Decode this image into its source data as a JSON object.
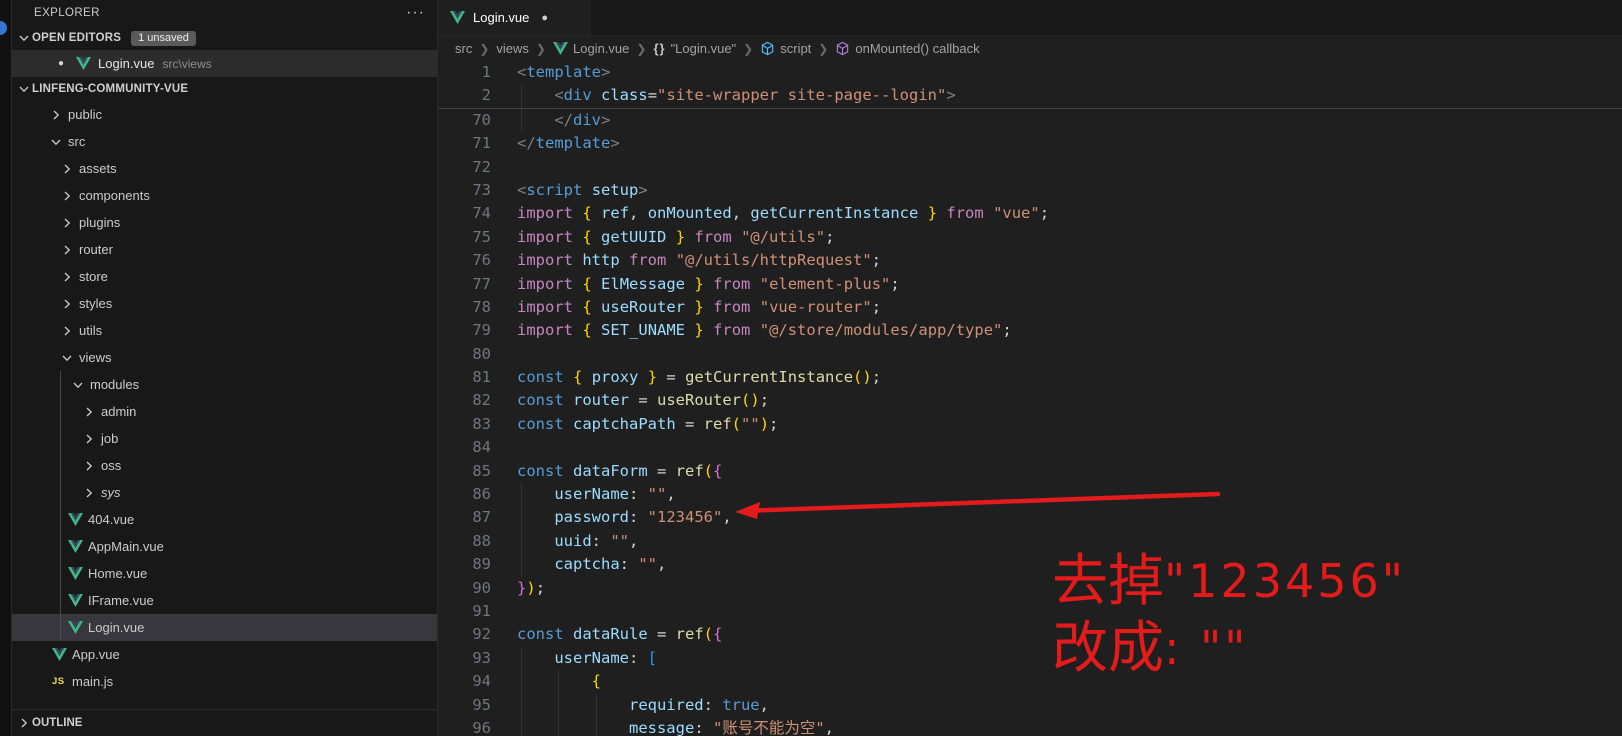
{
  "colors": {
    "annotation_red": "#e31b1b",
    "vue_green": "#41b883",
    "vue_dark": "#35495e",
    "activity_badge_blue": "#3574d4",
    "cube_blue": "#4fc1ff",
    "cube_purple": "#b180d7"
  },
  "explorer": {
    "title": "EXPLORER",
    "actions_icon": "···",
    "open_editors": {
      "label": "OPEN EDITORS",
      "badge": "1 unsaved",
      "items": [
        {
          "name": "Login.vue",
          "path": "src\\views",
          "modified": true,
          "icon": "vue"
        }
      ]
    },
    "project": {
      "label": "LINFENG-COMMUNITY-VUE",
      "tree": [
        {
          "label": "public",
          "kind": "folder",
          "expanded": false,
          "depth": 0
        },
        {
          "label": "src",
          "kind": "folder",
          "expanded": true,
          "depth": 0
        },
        {
          "label": "assets",
          "kind": "folder",
          "expanded": false,
          "depth": 1
        },
        {
          "label": "components",
          "kind": "folder",
          "expanded": false,
          "depth": 1
        },
        {
          "label": "plugins",
          "kind": "folder",
          "expanded": false,
          "depth": 1
        },
        {
          "label": "router",
          "kind": "folder",
          "expanded": false,
          "depth": 1
        },
        {
          "label": "store",
          "kind": "folder",
          "expanded": false,
          "depth": 1
        },
        {
          "label": "styles",
          "kind": "folder",
          "expanded": false,
          "depth": 1
        },
        {
          "label": "utils",
          "kind": "folder",
          "expanded": false,
          "depth": 1
        },
        {
          "label": "views",
          "kind": "folder",
          "expanded": true,
          "depth": 1
        },
        {
          "label": "modules",
          "kind": "folder",
          "expanded": true,
          "depth": 2
        },
        {
          "label": "admin",
          "kind": "folder",
          "expanded": false,
          "depth": 3
        },
        {
          "label": "job",
          "kind": "folder",
          "expanded": false,
          "depth": 3
        },
        {
          "label": "oss",
          "kind": "folder",
          "expanded": false,
          "depth": 3
        },
        {
          "label": "sys",
          "kind": "folder",
          "expanded": false,
          "depth": 3,
          "italic": true
        },
        {
          "label": "404.vue",
          "kind": "vue",
          "depth": 2
        },
        {
          "label": "AppMain.vue",
          "kind": "vue",
          "depth": 2
        },
        {
          "label": "Home.vue",
          "kind": "vue",
          "depth": 2
        },
        {
          "label": "IFrame.vue",
          "kind": "vue",
          "depth": 2
        },
        {
          "label": "Login.vue",
          "kind": "vue",
          "depth": 2,
          "selected": true
        },
        {
          "label": "App.vue",
          "kind": "vue",
          "depth": 0
        },
        {
          "label": "main.js",
          "kind": "js",
          "depth": 0
        }
      ]
    },
    "outline": {
      "label": "OUTLINE"
    }
  },
  "editor": {
    "tab": {
      "label": "Login.vue",
      "modified": true,
      "icon": "vue"
    },
    "breadcrumbs": [
      {
        "label": "src"
      },
      {
        "label": "views"
      },
      {
        "label": "Login.vue",
        "icon": "vue"
      },
      {
        "label": "\"Login.vue\"",
        "icon": "braces"
      },
      {
        "label": "script",
        "icon": "cube-blue"
      },
      {
        "label": "onMounted() callback",
        "icon": "cube-purple"
      }
    ],
    "sticky_lines": [
      {
        "num": "1",
        "tokens": [
          [
            "g",
            "<"
          ],
          [
            "t",
            "template"
          ],
          [
            "g",
            ">"
          ]
        ]
      },
      {
        "num": "2",
        "tokens": [
          [
            "p",
            "    "
          ],
          [
            "g",
            "<"
          ],
          [
            "t",
            "div"
          ],
          [
            "p",
            " "
          ],
          [
            "a",
            "class"
          ],
          [
            "p",
            "="
          ],
          [
            "s",
            "\"site-wrapper site-page--login\""
          ],
          [
            "g",
            ">"
          ]
        ]
      }
    ],
    "code_lines": [
      {
        "num": "70",
        "tokens": [
          [
            "p",
            "    "
          ],
          [
            "g",
            "</"
          ],
          [
            "t",
            "div"
          ],
          [
            "g",
            ">"
          ]
        ]
      },
      {
        "num": "71",
        "tokens": [
          [
            "g",
            "</"
          ],
          [
            "t",
            "template"
          ],
          [
            "g",
            ">"
          ]
        ]
      },
      {
        "num": "72",
        "tokens": []
      },
      {
        "num": "73",
        "tokens": [
          [
            "g",
            "<"
          ],
          [
            "t",
            "script"
          ],
          [
            "p",
            " "
          ],
          [
            "a",
            "setup"
          ],
          [
            "g",
            ">"
          ]
        ]
      },
      {
        "num": "74",
        "tokens": [
          [
            "i",
            "import"
          ],
          [
            "p",
            " "
          ],
          [
            "b1",
            "{"
          ],
          [
            "p",
            " "
          ],
          [
            "v",
            "ref"
          ],
          [
            "p",
            ", "
          ],
          [
            "v",
            "onMounted"
          ],
          [
            "p",
            ", "
          ],
          [
            "v",
            "getCurrentInstance"
          ],
          [
            "p",
            " "
          ],
          [
            "b1",
            "}"
          ],
          [
            "p",
            " "
          ],
          [
            "i",
            "from"
          ],
          [
            "p",
            " "
          ],
          [
            "s",
            "\"vue\""
          ],
          [
            "p",
            ";"
          ]
        ]
      },
      {
        "num": "75",
        "tokens": [
          [
            "i",
            "import"
          ],
          [
            "p",
            " "
          ],
          [
            "b1",
            "{"
          ],
          [
            "p",
            " "
          ],
          [
            "v",
            "getUUID"
          ],
          [
            "p",
            " "
          ],
          [
            "b1",
            "}"
          ],
          [
            "p",
            " "
          ],
          [
            "i",
            "from"
          ],
          [
            "p",
            " "
          ],
          [
            "s",
            "\"@/utils\""
          ],
          [
            "p",
            ";"
          ]
        ]
      },
      {
        "num": "76",
        "tokens": [
          [
            "i",
            "import"
          ],
          [
            "p",
            " "
          ],
          [
            "v",
            "http"
          ],
          [
            "p",
            " "
          ],
          [
            "i",
            "from"
          ],
          [
            "p",
            " "
          ],
          [
            "s",
            "\"@/utils/httpRequest\""
          ],
          [
            "p",
            ";"
          ]
        ]
      },
      {
        "num": "77",
        "tokens": [
          [
            "i",
            "import"
          ],
          [
            "p",
            " "
          ],
          [
            "b1",
            "{"
          ],
          [
            "p",
            " "
          ],
          [
            "v",
            "ElMessage"
          ],
          [
            "p",
            " "
          ],
          [
            "b1",
            "}"
          ],
          [
            "p",
            " "
          ],
          [
            "i",
            "from"
          ],
          [
            "p",
            " "
          ],
          [
            "s",
            "\"element-plus\""
          ],
          [
            "p",
            ";"
          ]
        ]
      },
      {
        "num": "78",
        "tokens": [
          [
            "i",
            "import"
          ],
          [
            "p",
            " "
          ],
          [
            "b1",
            "{"
          ],
          [
            "p",
            " "
          ],
          [
            "v",
            "useRouter"
          ],
          [
            "p",
            " "
          ],
          [
            "b1",
            "}"
          ],
          [
            "p",
            " "
          ],
          [
            "i",
            "from"
          ],
          [
            "p",
            " "
          ],
          [
            "s",
            "\"vue-router\""
          ],
          [
            "p",
            ";"
          ]
        ]
      },
      {
        "num": "79",
        "tokens": [
          [
            "i",
            "import"
          ],
          [
            "p",
            " "
          ],
          [
            "b1",
            "{"
          ],
          [
            "p",
            " "
          ],
          [
            "v",
            "SET_UNAME"
          ],
          [
            "p",
            " "
          ],
          [
            "b1",
            "}"
          ],
          [
            "p",
            " "
          ],
          [
            "i",
            "from"
          ],
          [
            "p",
            " "
          ],
          [
            "s",
            "\"@/store/modules/app/type\""
          ],
          [
            "p",
            ";"
          ]
        ]
      },
      {
        "num": "80",
        "tokens": []
      },
      {
        "num": "81",
        "tokens": [
          [
            "k",
            "const"
          ],
          [
            "p",
            " "
          ],
          [
            "b1",
            "{"
          ],
          [
            "p",
            " "
          ],
          [
            "v",
            "proxy"
          ],
          [
            "p",
            " "
          ],
          [
            "b1",
            "}"
          ],
          [
            "p",
            " = "
          ],
          [
            "f",
            "getCurrentInstance"
          ],
          [
            "b1",
            "()"
          ],
          [
            "p",
            ";"
          ]
        ]
      },
      {
        "num": "82",
        "tokens": [
          [
            "k",
            "const"
          ],
          [
            "p",
            " "
          ],
          [
            "v",
            "router"
          ],
          [
            "p",
            " = "
          ],
          [
            "f",
            "useRouter"
          ],
          [
            "b1",
            "()"
          ],
          [
            "p",
            ";"
          ]
        ]
      },
      {
        "num": "83",
        "tokens": [
          [
            "k",
            "const"
          ],
          [
            "p",
            " "
          ],
          [
            "v",
            "captchaPath"
          ],
          [
            "p",
            " = "
          ],
          [
            "f",
            "ref"
          ],
          [
            "b1",
            "("
          ],
          [
            "s",
            "\"\""
          ],
          [
            "b1",
            ")"
          ],
          [
            "p",
            ";"
          ]
        ]
      },
      {
        "num": "84",
        "tokens": []
      },
      {
        "num": "85",
        "tokens": [
          [
            "k",
            "const"
          ],
          [
            "p",
            " "
          ],
          [
            "v",
            "dataForm"
          ],
          [
            "p",
            " = "
          ],
          [
            "f",
            "ref"
          ],
          [
            "b1",
            "("
          ],
          [
            "b2",
            "{"
          ]
        ]
      },
      {
        "num": "86",
        "tokens": [
          [
            "p",
            "    "
          ],
          [
            "a",
            "userName"
          ],
          [
            "p",
            ": "
          ],
          [
            "s",
            "\"\""
          ],
          [
            "p",
            ","
          ]
        ]
      },
      {
        "num": "87",
        "tokens": [
          [
            "p",
            "    "
          ],
          [
            "a",
            "password"
          ],
          [
            "p",
            ": "
          ],
          [
            "s",
            "\"123456\""
          ],
          [
            "p",
            ","
          ]
        ]
      },
      {
        "num": "88",
        "tokens": [
          [
            "p",
            "    "
          ],
          [
            "a",
            "uuid"
          ],
          [
            "p",
            ": "
          ],
          [
            "s",
            "\"\""
          ],
          [
            "p",
            ","
          ]
        ]
      },
      {
        "num": "89",
        "tokens": [
          [
            "p",
            "    "
          ],
          [
            "a",
            "captcha"
          ],
          [
            "p",
            ": "
          ],
          [
            "s",
            "\"\""
          ],
          [
            "p",
            ","
          ]
        ]
      },
      {
        "num": "90",
        "tokens": [
          [
            "b2",
            "}"
          ],
          [
            "b1",
            ")"
          ],
          [
            "p",
            ";"
          ]
        ]
      },
      {
        "num": "91",
        "tokens": []
      },
      {
        "num": "92",
        "tokens": [
          [
            "k",
            "const"
          ],
          [
            "p",
            " "
          ],
          [
            "v",
            "dataRule"
          ],
          [
            "p",
            " = "
          ],
          [
            "f",
            "ref"
          ],
          [
            "b1",
            "("
          ],
          [
            "b2",
            "{"
          ]
        ]
      },
      {
        "num": "93",
        "tokens": [
          [
            "p",
            "    "
          ],
          [
            "a",
            "userName"
          ],
          [
            "p",
            ": "
          ],
          [
            "b3",
            "["
          ]
        ]
      },
      {
        "num": "94",
        "tokens": [
          [
            "p",
            "        "
          ],
          [
            "b1",
            "{"
          ]
        ]
      },
      {
        "num": "95",
        "tokens": [
          [
            "p",
            "            "
          ],
          [
            "a",
            "required"
          ],
          [
            "p",
            ": "
          ],
          [
            "k",
            "true"
          ],
          [
            "p",
            ","
          ]
        ]
      },
      {
        "num": "96",
        "tokens": [
          [
            "p",
            "            "
          ],
          [
            "a",
            "message"
          ],
          [
            "p",
            ": "
          ],
          [
            "s",
            "\"账号不能为空\""
          ],
          [
            "p",
            ","
          ]
        ]
      }
    ]
  },
  "annotation": {
    "line1_hanzi": "去掉",
    "line1_code": "\"123456\"",
    "line2_hanzi": "改成",
    "line2_code": ": \"\""
  }
}
